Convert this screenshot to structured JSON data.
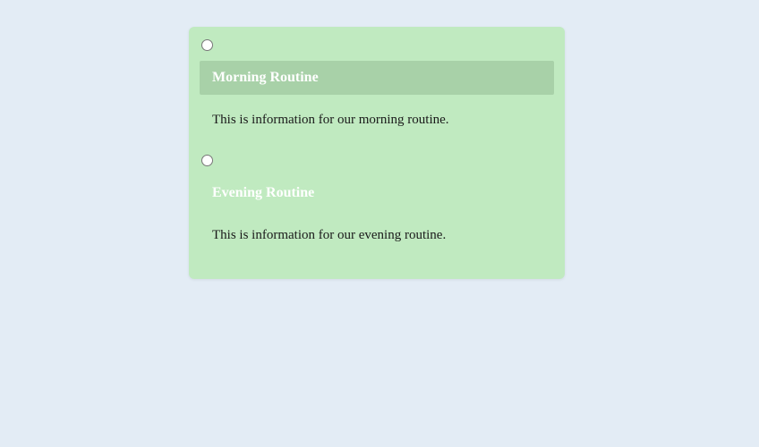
{
  "sections": [
    {
      "title": "Morning Routine",
      "description": "This is information for our morning routine.",
      "selected": true
    },
    {
      "title": "Evening Routine",
      "description": "This is information for our evening routine.",
      "selected": false
    }
  ]
}
